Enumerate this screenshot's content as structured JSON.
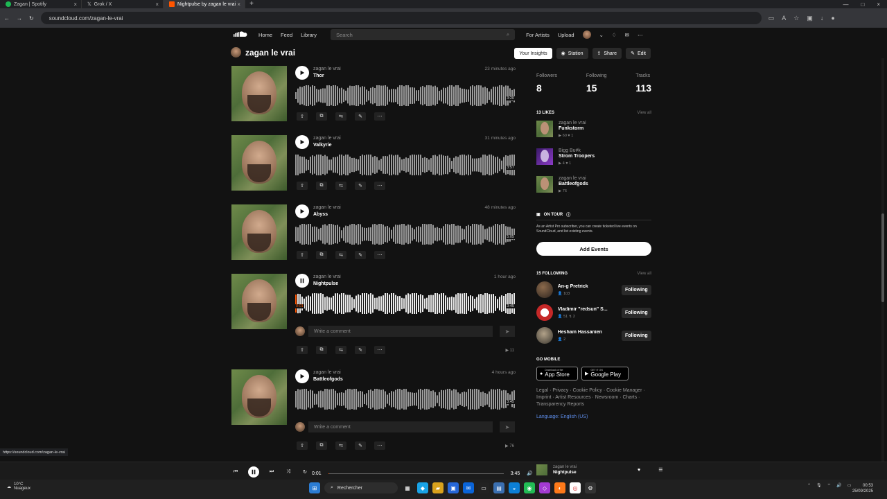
{
  "browser": {
    "tabs": [
      {
        "label": "Zagan | Spotify"
      },
      {
        "label": "Grok / X"
      },
      {
        "label": "Nightpulse by zagan le vrai"
      }
    ],
    "url": "soundcloud.com/zagan-le-vrai",
    "status_url": "https://soundcloud.com/zagan-le-vrai"
  },
  "nav": {
    "home": "Home",
    "feed": "Feed",
    "library": "Library",
    "search_placeholder": "Search",
    "for_artists": "For Artists",
    "upload": "Upload"
  },
  "profile": {
    "name": "zagan le vrai",
    "buttons": {
      "insights": "Your Insights",
      "station": "Station",
      "share": "Share",
      "edit": "Edit"
    }
  },
  "tracks": [
    {
      "artist": "zagan le vrai",
      "title": "Thor",
      "age": "23 minutes ago",
      "duration": "3:20",
      "playing": false
    },
    {
      "artist": "zagan le vrai",
      "title": "Valkyrie",
      "age": "31 minutes ago",
      "duration": "3:57",
      "playing": false
    },
    {
      "artist": "zagan le vrai",
      "title": "Abyss",
      "age": "48 minutes ago",
      "duration": "5:05",
      "playing": false
    },
    {
      "artist": "zagan le vrai",
      "title": "Nightpulse",
      "age": "1 hour ago",
      "duration": "3:45",
      "elapsed": "0:01",
      "playing": true,
      "comment_placeholder": "Write a comment",
      "plays": "11"
    },
    {
      "artist": "zagan le vrai",
      "title": "Battleofgods",
      "age": "4 hours ago",
      "duration": "3:45",
      "playing": false,
      "comment_placeholder": "Write a comment",
      "plays": "76"
    }
  ],
  "sidebar": {
    "stats": [
      {
        "label": "Followers",
        "value": "8"
      },
      {
        "label": "Following",
        "value": "15"
      },
      {
        "label": "Tracks",
        "value": "113"
      }
    ],
    "likes_heading": "13 LIKES",
    "view_all": "View all",
    "likes": [
      {
        "user": "zagan le vrai",
        "title": "Funkstorm",
        "plays": "60",
        "likes": "1"
      },
      {
        "user": "Bigg Bu#k",
        "title": "Strom Troopers",
        "plays": "4",
        "likes": "1"
      },
      {
        "user": "zagan le vrai",
        "title": "Battleofgods",
        "plays": "76",
        "likes": ""
      }
    ],
    "tour": {
      "heading": "ON TOUR",
      "text": "As an Artist Pro subscriber, you can create ticketed live events on SoundCloud, and list existing events.",
      "button": "Add Events"
    },
    "following_heading": "15 FOLLOWING",
    "following": [
      {
        "name": "An-g Pretrick",
        "followers": "103",
        "tracks": "",
        "button": "Following"
      },
      {
        "name": "Vladimir \"redsun\" S...",
        "followers": "51",
        "tracks": "2",
        "button": "Following"
      },
      {
        "name": "Hesham Hassanien",
        "followers": "2",
        "tracks": "",
        "button": "Following"
      }
    ],
    "mobile_heading": "GO MOBILE",
    "app_store": {
      "small": "Download on the",
      "big": "App Store"
    },
    "google_play": {
      "small": "GET IT ON",
      "big": "Google Play"
    },
    "footer_links": "Legal · Privacy · Cookie Policy · Cookie Manager · Imprint · Artist Resources · Newsroom · Charts · Transparency Reports",
    "language_label": "Language:",
    "language": "English (US)"
  },
  "player": {
    "elapsed": "0:01",
    "duration": "3:45",
    "progress": 0.004,
    "artist": "zagan le vrai",
    "title": "Nightpulse"
  },
  "taskbar": {
    "temperature": "10°C",
    "weather": "Nuageux",
    "search": "Rechercher",
    "time": "00:53",
    "date": "25/09/2025"
  },
  "colors": {
    "accent": "#ff5500",
    "background": "#121212",
    "link": "#5d8ce8"
  }
}
